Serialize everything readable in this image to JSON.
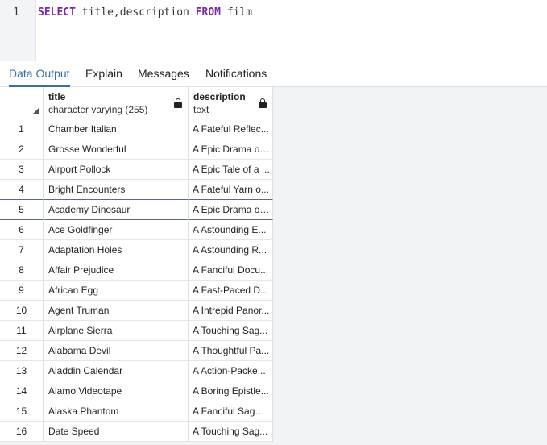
{
  "editor": {
    "line_number": "1",
    "tokens": [
      {
        "text": "SELECT",
        "kw": true
      },
      {
        "text": " title,description ",
        "kw": false
      },
      {
        "text": "FROM",
        "kw": true
      },
      {
        "text": " film",
        "kw": false
      }
    ]
  },
  "tabs": [
    {
      "label": "Data Output",
      "active": true
    },
    {
      "label": "Explain",
      "active": false
    },
    {
      "label": "Messages",
      "active": false
    },
    {
      "label": "Notifications",
      "active": false
    }
  ],
  "grid": {
    "columns": [
      {
        "name": "title",
        "type": "character varying (255)",
        "icon": "lock-icon"
      },
      {
        "name": "description",
        "type": "text",
        "icon": "lock-icon"
      }
    ],
    "rows": [
      {
        "n": "1",
        "title": "Chamber Italian",
        "description": "A Fateful Reflec..."
      },
      {
        "n": "2",
        "title": "Grosse Wonderful",
        "description": "A Epic Drama of..."
      },
      {
        "n": "3",
        "title": "Airport Pollock",
        "description": "A Epic Tale of a ..."
      },
      {
        "n": "4",
        "title": "Bright Encounters",
        "description": "A Fateful Yarn o..."
      },
      {
        "n": "5",
        "title": "Academy Dinosaur",
        "description": "A Epic Drama of..."
      },
      {
        "n": "6",
        "title": "Ace Goldfinger",
        "description": "A Astounding E..."
      },
      {
        "n": "7",
        "title": "Adaptation Holes",
        "description": "A Astounding R..."
      },
      {
        "n": "8",
        "title": "Affair Prejudice",
        "description": "A Fanciful Docu..."
      },
      {
        "n": "9",
        "title": "African Egg",
        "description": "A Fast-Paced D..."
      },
      {
        "n": "10",
        "title": "Agent Truman",
        "description": "A Intrepid Panor..."
      },
      {
        "n": "11",
        "title": "Airplane Sierra",
        "description": "A Touching Sag..."
      },
      {
        "n": "12",
        "title": "Alabama Devil",
        "description": "A Thoughtful Pa..."
      },
      {
        "n": "13",
        "title": "Aladdin Calendar",
        "description": "A Action-Packe..."
      },
      {
        "n": "14",
        "title": "Alamo Videotape",
        "description": "A Boring Epistle..."
      },
      {
        "n": "15",
        "title": "Alaska Phantom",
        "description": "A Fanciful Saga ..."
      },
      {
        "n": "16",
        "title": "Date Speed",
        "description": "A Touching Sag..."
      }
    ],
    "selected_row": "5"
  }
}
